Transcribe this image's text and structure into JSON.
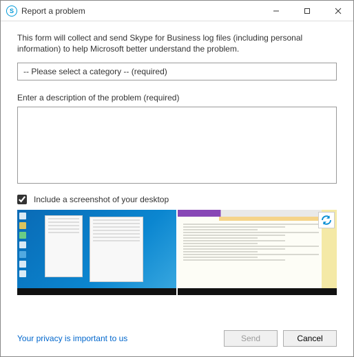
{
  "window": {
    "title": "Report a problem"
  },
  "form": {
    "intro": "This form will collect and send Skype for Business log files (including personal information) to help Microsoft better understand the problem.",
    "category_placeholder": "-- Please select a category -- (required)",
    "description_label": "Enter a description of the problem (required)",
    "description_value": "",
    "include_screenshot_label": "Include a screenshot of your desktop",
    "include_screenshot_checked": true
  },
  "footer": {
    "privacy_link": "Your privacy is important to us",
    "send_label": "Send",
    "cancel_label": "Cancel"
  }
}
